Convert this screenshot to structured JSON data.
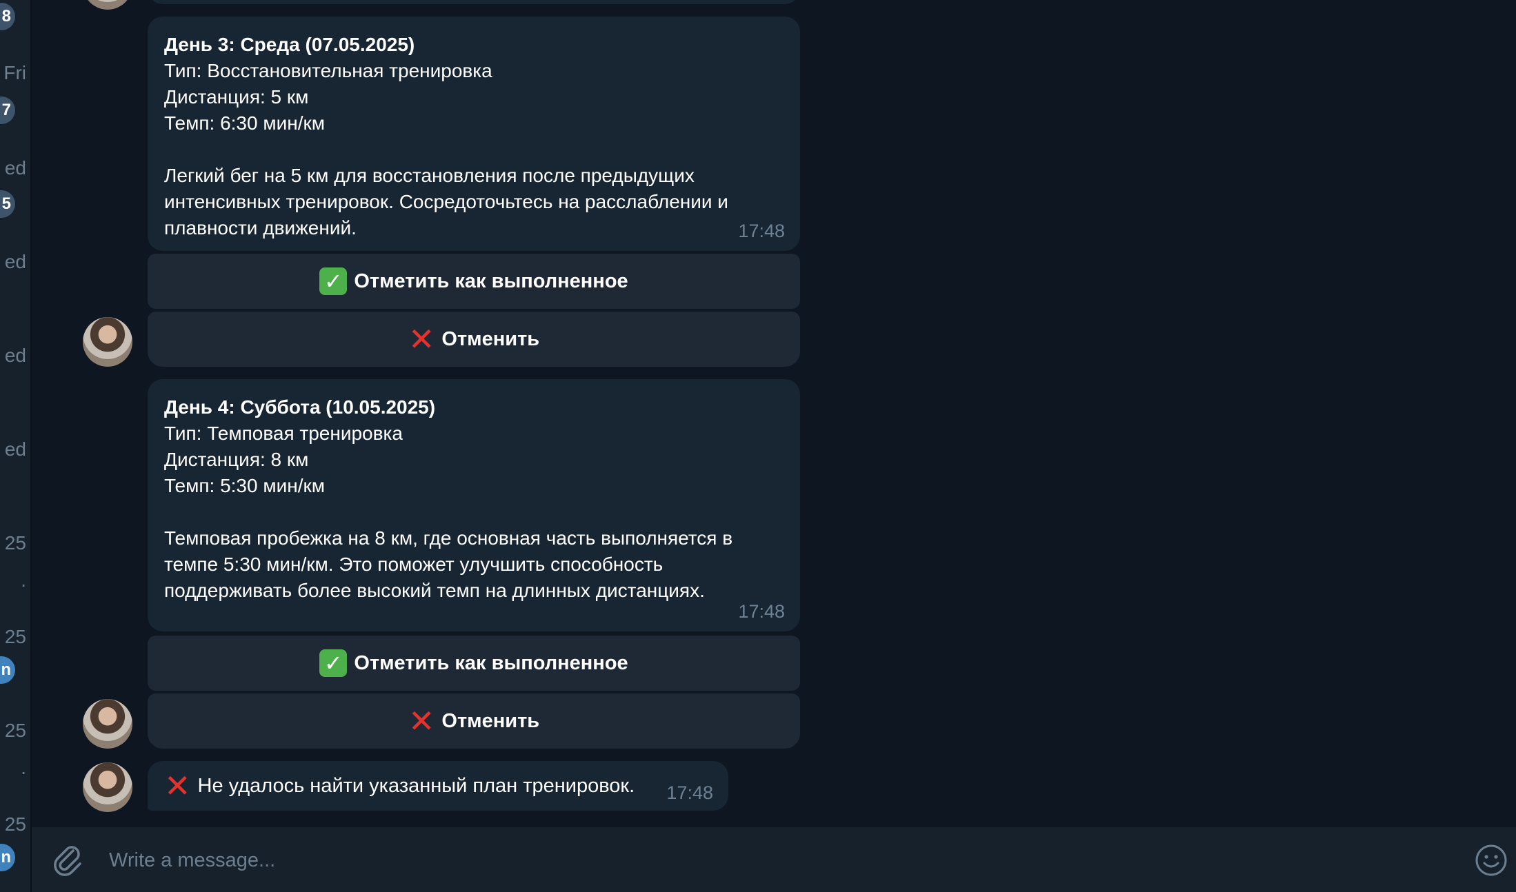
{
  "sidebar": {
    "times": [
      "Fri",
      "ed",
      "ed",
      "ed",
      "ed",
      "25",
      ".",
      "25",
      "25",
      ".",
      "25"
    ],
    "badges": [
      "8",
      "7",
      "5",
      "n",
      "n"
    ]
  },
  "messages": [
    {
      "title": "День 3: Среда (07.05.2025)",
      "type": "Тип: Восстановительная тренировка",
      "distance": "Дистанция: 5 км",
      "pace": "Темп: 6:30 мин/км",
      "description": [
        "Легкий бег на 5 км для восстановления после предыдущих",
        "интенсивных тренировок. Сосредоточьтесь на расслаблении и",
        "плавности движений."
      ],
      "time": "17:48",
      "done_label": "Отметить как выполненное",
      "cancel_label": "Отменить"
    },
    {
      "title": "День 4: Суббота (10.05.2025)",
      "type": "Тип: Темповая тренировка",
      "distance": "Дистанция: 8 км",
      "pace": "Темп: 5:30 мин/км",
      "description": [
        "Темповая пробежка на 8 км, где основная часть выполняется в",
        "темпе 5:30 мин/км. Это поможет улучшить способность",
        "поддерживать более высокий темп на длинных дистанциях."
      ],
      "time": "17:48",
      "done_label": "Отметить как выполненное",
      "cancel_label": "Отменить"
    }
  ],
  "error_message": {
    "text": "Не удалось найти указанный план тренировок.",
    "time": "17:48"
  },
  "composer": {
    "placeholder": "Write a message..."
  },
  "icons": {
    "check": "check-mark-emoji",
    "cross": "cross-mark-emoji",
    "attach": "paperclip-icon",
    "emoji": "smile-icon"
  },
  "colors": {
    "background": "#0e1621",
    "bubble": "#182533",
    "button": "#1f2936",
    "composer": "#17212b"
  }
}
